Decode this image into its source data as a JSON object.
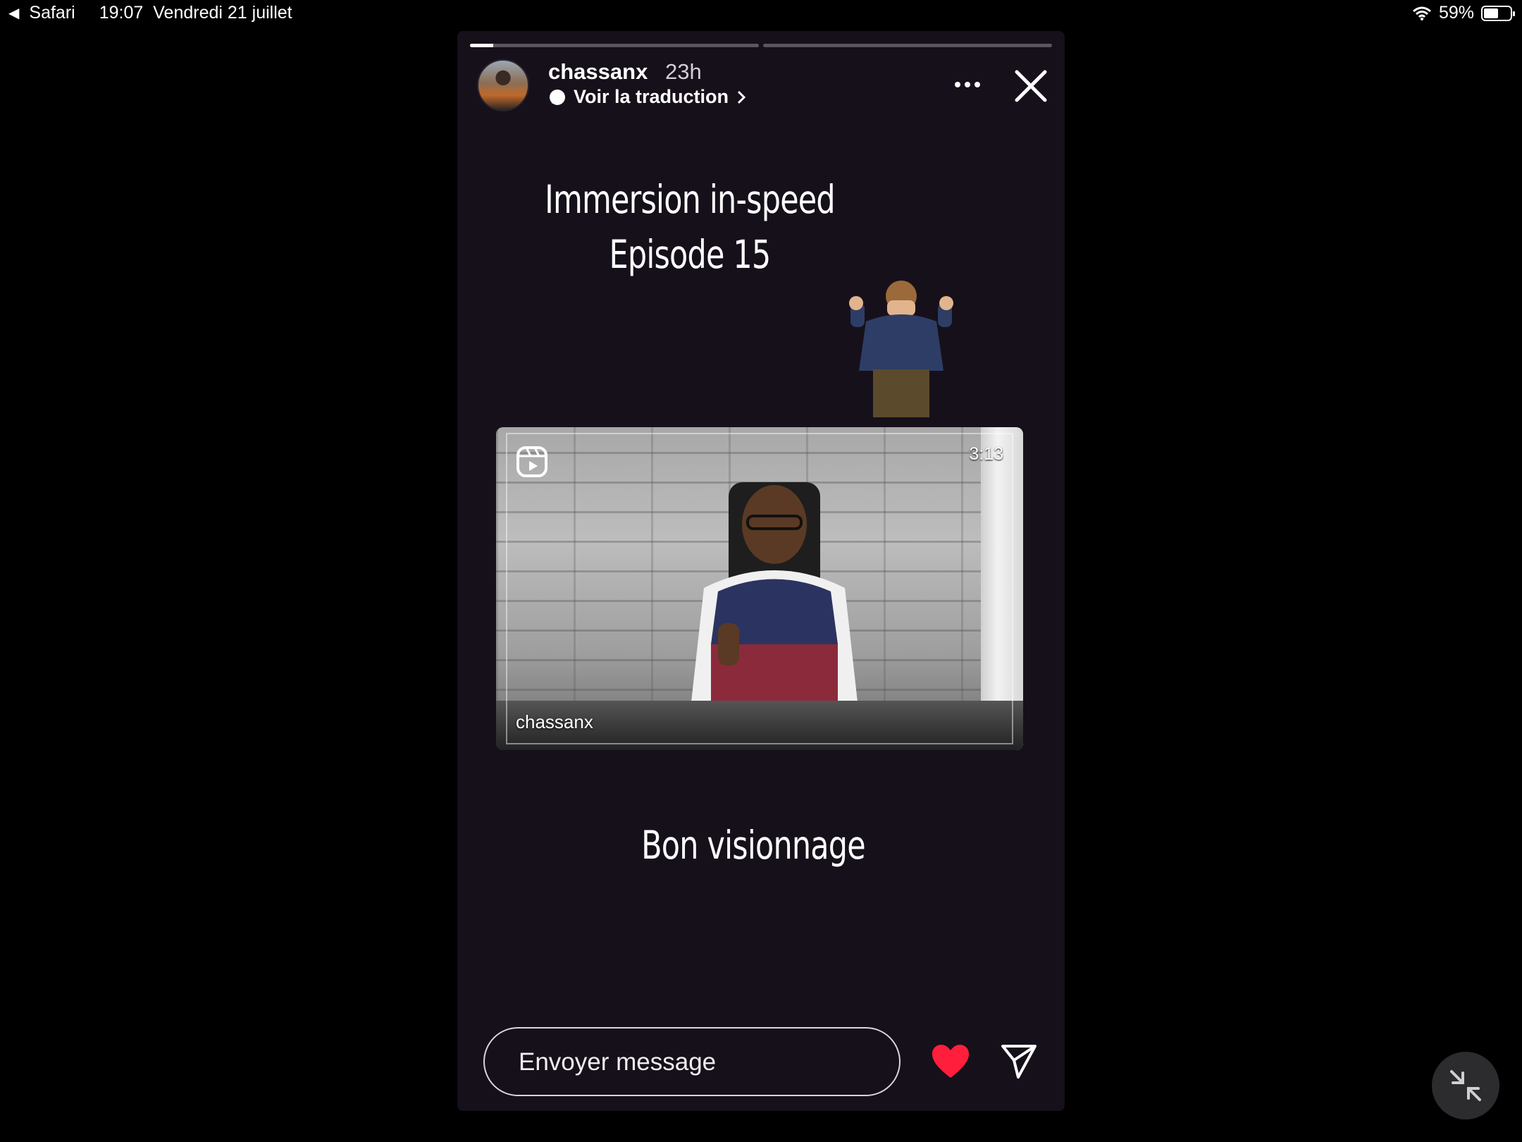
{
  "status_bar": {
    "back_app": "Safari",
    "time": "19:07",
    "date": "Vendredi 21 juillet",
    "battery": "59%",
    "battery_level": 0.59
  },
  "story": {
    "progress": {
      "segments": 2,
      "current_segment": 1,
      "current_fraction": 0.08
    },
    "username": "chassanx",
    "posted_ago": "23h",
    "translate_label": "Voir la traduction",
    "title_line1": "Immersion in-speed",
    "title_line2": "Episode 15",
    "reel": {
      "duration": "3:13",
      "author": "chassanx"
    },
    "caption": "Bon visionnage"
  },
  "footer": {
    "message_placeholder": "Envoyer message"
  },
  "colors": {
    "background": "#000000",
    "story_bg": "#16101a",
    "like": "#ff1f3d"
  },
  "icons": [
    "avatar",
    "translate-bubble-icon",
    "chevron-right-icon",
    "more-icon",
    "close-icon",
    "reel-icon",
    "heart-icon",
    "send-icon",
    "minimize-icon"
  ]
}
